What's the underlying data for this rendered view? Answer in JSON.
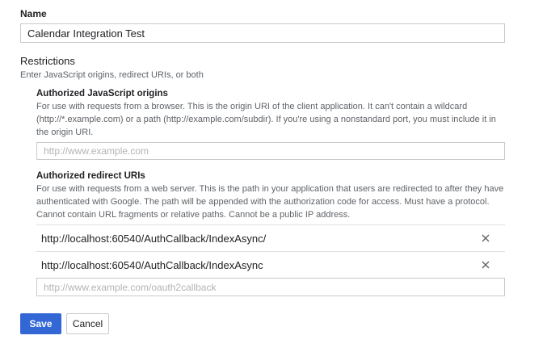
{
  "name": {
    "label": "Name",
    "value": "Calendar Integration Test"
  },
  "restrictions": {
    "title": "Restrictions",
    "subtitle": "Enter JavaScript origins, redirect URIs, or both",
    "js_origins": {
      "title": "Authorized JavaScript origins",
      "help_lines": [
        "For use with requests from a browser. This is the origin URI of the client application. It can't contain a wildcard",
        "(http://*.example.com) or a path (http://example.com/subdir). If you're using a nonstandard port, you must include it in",
        "the origin URI."
      ],
      "placeholder": "http://www.example.com"
    },
    "redirect_uris": {
      "title": "Authorized redirect URIs",
      "help_lines": [
        "For use with requests from a web server. This is the path in your application that users are redirected to after they have",
        "authenticated with Google. The path will be appended with the authorization code for access. Must have a protocol.",
        "Cannot contain URL fragments or relative paths. Cannot be a public IP address."
      ],
      "items": [
        "http://localhost:60540/AuthCallback/IndexAsync/",
        "http://localhost:60540/AuthCallback/IndexAsync"
      ],
      "remove_icon": "close-icon",
      "placeholder": "http://www.example.com/oauth2callback"
    }
  },
  "actions": {
    "save_label": "Save",
    "cancel_label": "Cancel"
  },
  "colors": {
    "primary": "#3367d6",
    "help_text": "#5f6368",
    "border": "#c9c9c9"
  }
}
